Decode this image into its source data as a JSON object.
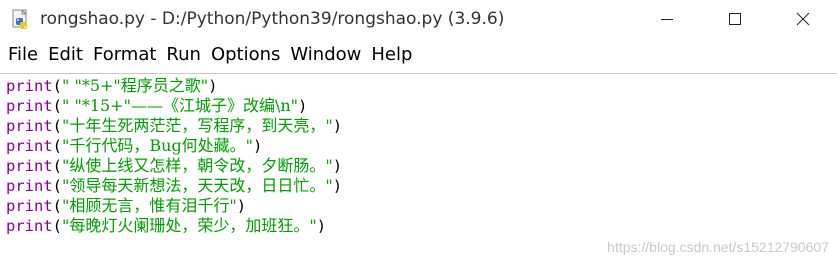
{
  "window": {
    "title": "rongshao.py - D:/Python/Python39/rongshao.py (3.9.6)",
    "icon": "python-file-icon",
    "controls": {
      "minimize": "minimize-icon",
      "maximize": "maximize-icon",
      "close": "close-icon"
    }
  },
  "menu": {
    "items": [
      {
        "label": "File"
      },
      {
        "label": "Edit"
      },
      {
        "label": "Format"
      },
      {
        "label": "Run"
      },
      {
        "label": "Options"
      },
      {
        "label": "Window"
      },
      {
        "label": "Help"
      }
    ]
  },
  "editor": {
    "lines": [
      {
        "keyword": "print",
        "open": "(",
        "string": "\" \"*5+\"程序员之歌\"",
        "close": ")"
      },
      {
        "keyword": "print",
        "open": "(",
        "string": "\" \"*15+\"——《江城子》改编\\n\"",
        "close": ")"
      },
      {
        "keyword": "print",
        "open": "(",
        "string": "\"十年生死两茫茫，写程序，到天亮，\"",
        "close": ")"
      },
      {
        "keyword": "print",
        "open": "(",
        "string": "\"千行代码，Bug何处藏。\"",
        "close": ")"
      },
      {
        "keyword": "print",
        "open": "(",
        "string": "\"纵使上线又怎样，朝令改，夕断肠。\"",
        "close": ")"
      },
      {
        "keyword": "print",
        "open": "(",
        "string": "\"领导每天新想法，天天改，日日忙。\"",
        "close": ")"
      },
      {
        "keyword": "print",
        "open": "(",
        "string": "\"相顾无言，惟有泪千行\"",
        "close": ")"
      },
      {
        "keyword": "print",
        "open": "(",
        "string": "\"每晚灯火阑珊处，荣少，加班狂。\"",
        "close": ")"
      }
    ]
  },
  "watermark": "https://blog.csdn.net/s15212790607",
  "colors": {
    "keyword": "#900090",
    "string": "#00a000",
    "punctuation": "#000000",
    "title_text": "#333333",
    "watermark": "#c8c8c8"
  }
}
